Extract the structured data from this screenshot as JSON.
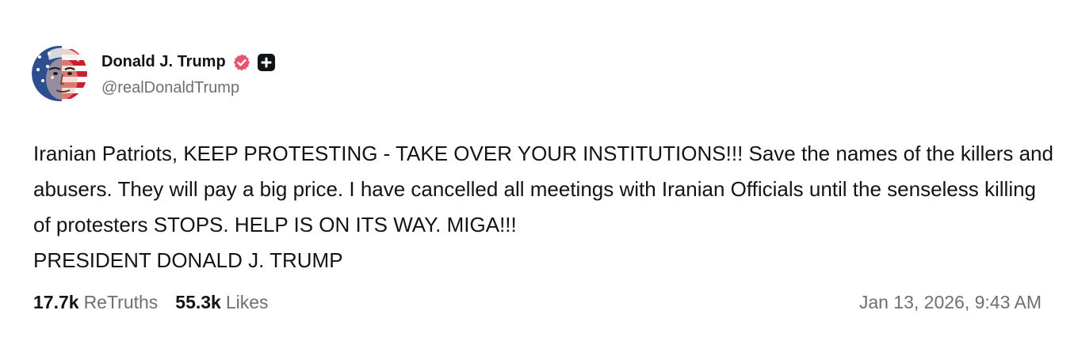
{
  "post": {
    "author": {
      "display_name": "Donald J. Trump",
      "handle": "@realDonaldTrump",
      "avatar": "flag-painted-face-avatar",
      "verified_icon": "verified-badge-icon",
      "plus_icon": "plus-badge-icon"
    },
    "body": "Iranian Patriots, KEEP PROTESTING - TAKE OVER YOUR INSTITUTIONS!!! Save the names of the killers and abusers. They will pay a big price. I have cancelled all meetings with Iranian Officials until the senseless killing of protesters STOPS. HELP IS ON ITS WAY. MIGA!!!\nPRESIDENT DONALD J. TRUMP",
    "stats": {
      "retruths_count": "17.7k",
      "retruths_label": "ReTruths",
      "likes_count": "55.3k",
      "likes_label": "Likes"
    },
    "timestamp": "Jan 13, 2026, 9:43 AM"
  },
  "colors": {
    "verified_badge": "#e8546f",
    "plus_badge": "#0f1419",
    "muted_text": "#6b6f76"
  }
}
